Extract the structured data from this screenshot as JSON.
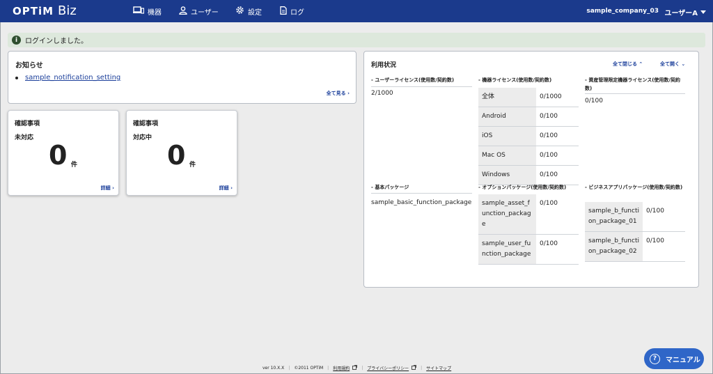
{
  "header": {
    "logo_main": "OPTiM",
    "logo_sub": "Biz",
    "nav": {
      "devices": "機器",
      "users": "ユーザー",
      "settings": "設定",
      "log": "ログ"
    },
    "company": "sample_company_03",
    "user": "ユーザーA"
  },
  "alert": {
    "icon": "i",
    "message": "ログインしました。"
  },
  "notice": {
    "title": "お知らせ",
    "items": [
      "sample_notification_setting"
    ],
    "see_all": "全て見る ›"
  },
  "confirm_cards": [
    {
      "title": "確認事項",
      "state": "未対応",
      "count": "0",
      "unit": "件",
      "detail": "詳細 ›"
    },
    {
      "title": "確認事項",
      "state": "対応中",
      "count": "0",
      "unit": "件",
      "detail": "詳細 ›"
    }
  ],
  "usage": {
    "title": "利用状況",
    "collapse_all": "全て閉じる ⌃",
    "expand_all": "全て開く ⌄",
    "user_license": {
      "title": "- ユーザーライセンス(使用数/契約数)",
      "value": "2/1000"
    },
    "device_license": {
      "title": "- 機器ライセンス(使用数/契約数)",
      "rows": [
        {
          "k": "全体",
          "v": "0/1000"
        },
        {
          "k": "Android",
          "v": "0/100"
        },
        {
          "k": "iOS",
          "v": "0/100"
        },
        {
          "k": "Mac OS",
          "v": "0/100"
        },
        {
          "k": "Windows",
          "v": "0/100"
        }
      ]
    },
    "asset_license": {
      "title": "- 資産管理限定機器ライセンス(使用数/契約数)",
      "value": "0/100"
    },
    "basic_package": {
      "title": "- 基本パッケージ",
      "value": "sample_basic_function_package"
    },
    "option_package": {
      "title": "- オプションパッケージ(使用数/契約数)",
      "rows": [
        {
          "k": "sample_asset_function_package",
          "v": "0/100"
        },
        {
          "k": "sample_user_function_package",
          "v": "0/100"
        }
      ]
    },
    "business_package": {
      "title": "- ビジネスアプリパッケージ(使用数/契約数)",
      "rows": [
        {
          "k": "sample_b_function_package_01",
          "v": "0/100"
        },
        {
          "k": "sample_b_function_package_02",
          "v": "0/100"
        }
      ]
    }
  },
  "footer": {
    "version": "ver 10.X.X",
    "copyright": "©2011 OPTiM",
    "terms": "利用規約",
    "privacy": "プライバシーポリシー",
    "sitemap": "サイトマップ"
  },
  "manual_button": "マニュアル",
  "colors": {
    "header": "#1b3a8c",
    "link": "#1a3e9a",
    "alert_bg": "#dde8dc",
    "manual_bg": "#2f66c8"
  }
}
